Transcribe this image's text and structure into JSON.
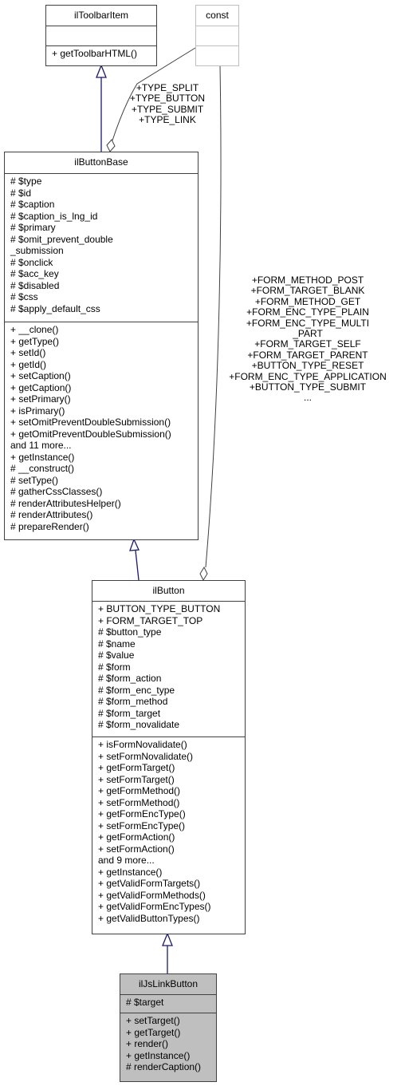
{
  "classes": {
    "toolbar_item": {
      "name": "ilToolbarItem",
      "attributes": [],
      "methods": [
        "+ getToolbarHTML()"
      ]
    },
    "const": {
      "name": "const",
      "attributes": [],
      "methods": []
    },
    "button_base": {
      "name": "ilButtonBase",
      "attributes": [
        "# $type",
        "# $id",
        "# $caption",
        "# $caption_is_lng_id",
        "# $primary",
        "# $omit_prevent_double",
        "_submission",
        "# $onclick",
        "# $acc_key",
        "# $disabled",
        "# $css",
        "# $apply_default_css"
      ],
      "methods": [
        "+ __clone()",
        "+ getType()",
        "+ setId()",
        "+ getId()",
        "+ setCaption()",
        "+ getCaption()",
        "+ setPrimary()",
        "+ isPrimary()",
        "+ setOmitPreventDoubleSubmission()",
        "+ getOmitPreventDoubleSubmission()",
        "and 11 more...",
        "+ getInstance()",
        "# __construct()",
        "# setType()",
        "# gatherCssClasses()",
        "# renderAttributesHelper()",
        "# renderAttributes()",
        "# prepareRender()"
      ]
    },
    "button": {
      "name": "ilButton",
      "attributes": [
        "+ BUTTON_TYPE_BUTTON",
        "+ FORM_TARGET_TOP",
        "# $button_type",
        "# $name",
        "# $value",
        "# $form",
        "# $form_action",
        "# $form_enc_type",
        "# $form_method",
        "# $form_target",
        "# $form_novalidate"
      ],
      "methods": [
        "+ isFormNovalidate()",
        "+ setFormNovalidate()",
        "+ getFormTarget()",
        "+ setFormTarget()",
        "+ getFormMethod()",
        "+ setFormMethod()",
        "+ getFormEncType()",
        "+ setFormEncType()",
        "+ getFormAction()",
        "+ setFormAction()",
        "and 9 more...",
        "+ getInstance()",
        "+ getValidFormTargets()",
        "+ getValidFormMethods()",
        "+ getValidFormEncTypes()",
        "+ getValidButtonTypes()"
      ]
    },
    "js_link_button": {
      "name": "ilJsLinkButton",
      "attributes": [
        "# $target"
      ],
      "methods": [
        "+ setTarget()",
        "+ getTarget()",
        "+ render()",
        "+ getInstance()",
        "# renderCaption()"
      ]
    }
  },
  "edge_labels": {
    "const_to_button_base": [
      "+TYPE_SPLIT",
      "+TYPE_BUTTON",
      "+TYPE_SUBMIT",
      "+TYPE_LINK"
    ],
    "const_to_button": [
      "+FORM_METHOD_POST",
      "+FORM_TARGET_BLANK",
      "+FORM_METHOD_GET",
      "+FORM_ENC_TYPE_PLAIN",
      "+FORM_ENC_TYPE_MULTI",
      "_PART",
      "+FORM_TARGET_SELF",
      "+FORM_TARGET_PARENT",
      "+BUTTON_TYPE_RESET",
      "+FORM_ENC_TYPE_APPLICATION",
      "+BUTTON_TYPE_SUBMIT",
      "..."
    ]
  },
  "colors": {
    "inheritance": "#191970",
    "composition": "#404040",
    "highlight_fill": "#bfbfbf",
    "external_border": "#bfbfbf"
  }
}
